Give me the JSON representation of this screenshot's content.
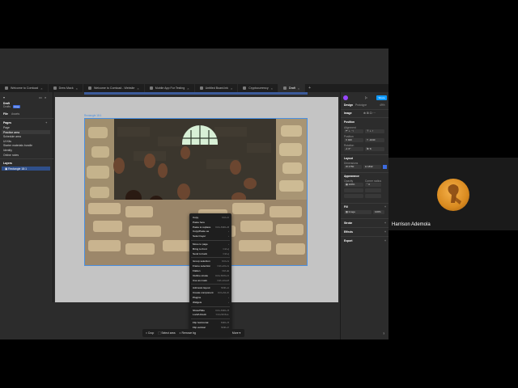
{
  "tabs": [
    {
      "label": "Welcome to Comload",
      "active": false
    },
    {
      "label": "Drew Mack",
      "active": false
    },
    {
      "label": "Welcome to Comload - Website",
      "active": false
    },
    {
      "label": "Mobile App For Testing",
      "active": false
    },
    {
      "label": "Untitled Board.ink",
      "active": false
    },
    {
      "label": "Cryptocurrency",
      "active": false
    },
    {
      "label": "Draft",
      "active": true
    }
  ],
  "left_panel": {
    "file_title": "Draft",
    "file_sub": "Drafts",
    "plan_badge": "Free",
    "file_tab": "File",
    "assets_tab": "Assets",
    "pages_heading": "Pages",
    "pages": [
      "Page",
      "Practice area",
      "Schedule area",
      "UI Kits",
      "Starter materials bundle",
      "Identity",
      "Online notes"
    ],
    "layers_heading": "Layers",
    "layer_selected": "Rectangle 18:1"
  },
  "photo_label": "Rectangle 18:1",
  "right_panel": {
    "share_label": "Share",
    "tab_design": "Design",
    "tab_prototype": "Prototype",
    "zoom": "49%",
    "image_heading": "Image",
    "position_heading": "Position",
    "alignment_label": "Alignment",
    "position_label": "Position",
    "x_value": "920",
    "y_value": "-1040",
    "rotation_label": "Rotation",
    "rotation_value": "0°",
    "layout_heading": "Layout",
    "dimensions_label": "Dimensions",
    "w_value": "2750",
    "h_value": "1832",
    "appearance_heading": "Appearance",
    "opacity_label": "Opacity",
    "opacity_value": "100%",
    "corner_label": "Corner radius",
    "corner_value": "0",
    "fill_heading": "Fill",
    "fill_value": "Image",
    "fill_opacity": "100%",
    "stroke_heading": "Stroke",
    "effects_heading": "Effects",
    "export_heading": "Export"
  },
  "context_menu": {
    "groups": [
      [
        {
          "label": "Copy",
          "shortcut": "Ctrl+C"
        },
        {
          "label": "Paste here",
          "shortcut": ""
        },
        {
          "label": "Paste to replace",
          "shortcut": "Ctrl+Shift+R"
        },
        {
          "label": "Copy/Paste as",
          "shortcut": "›"
        },
        {
          "label": "Select layer",
          "shortcut": "›"
        }
      ],
      [
        {
          "label": "Move to page",
          "shortcut": "›"
        },
        {
          "label": "Bring to front",
          "shortcut": "Ctrl+]"
        },
        {
          "label": "Send to back",
          "shortcut": "Ctrl+["
        }
      ],
      [
        {
          "label": "Group selection",
          "shortcut": "Ctrl+G"
        },
        {
          "label": "Frame selection",
          "shortcut": "Ctrl+Alt+G"
        },
        {
          "label": "Flatten",
          "shortcut": "Ctrl+E"
        },
        {
          "label": "Outline stroke",
          "shortcut": "Ctrl+Shift+O"
        },
        {
          "label": "Use as mask",
          "shortcut": "Ctrl+Alt+M"
        }
      ],
      [
        {
          "label": "Add auto layout",
          "shortcut": "Shift+A"
        },
        {
          "label": "Create component",
          "shortcut": "Ctrl+Alt+K"
        },
        {
          "label": "Plugins",
          "shortcut": "›"
        },
        {
          "label": "Widgets",
          "shortcut": "›"
        }
      ],
      [
        {
          "label": "Show/Hide",
          "shortcut": "Ctrl+Shift+H"
        },
        {
          "label": "Lock/Unlock",
          "shortcut": "Ctrl+Shift+L"
        }
      ],
      [
        {
          "label": "Flip horizontal",
          "shortcut": "Shift+H"
        },
        {
          "label": "Flip vertical",
          "shortcut": "Shift+V"
        }
      ]
    ]
  },
  "property_bar": {
    "crop": "Crop",
    "select_area": "Select area",
    "remove_bg": "Remove bg",
    "more": "More"
  },
  "toolbar": {
    "tools": [
      "move-icon",
      "frame-icon",
      "shape-icon",
      "pen-icon",
      "text-icon",
      "comment-icon",
      "actions-icon",
      "dev-mode-icon"
    ]
  },
  "participant": {
    "name": "Harrison Ademola"
  }
}
